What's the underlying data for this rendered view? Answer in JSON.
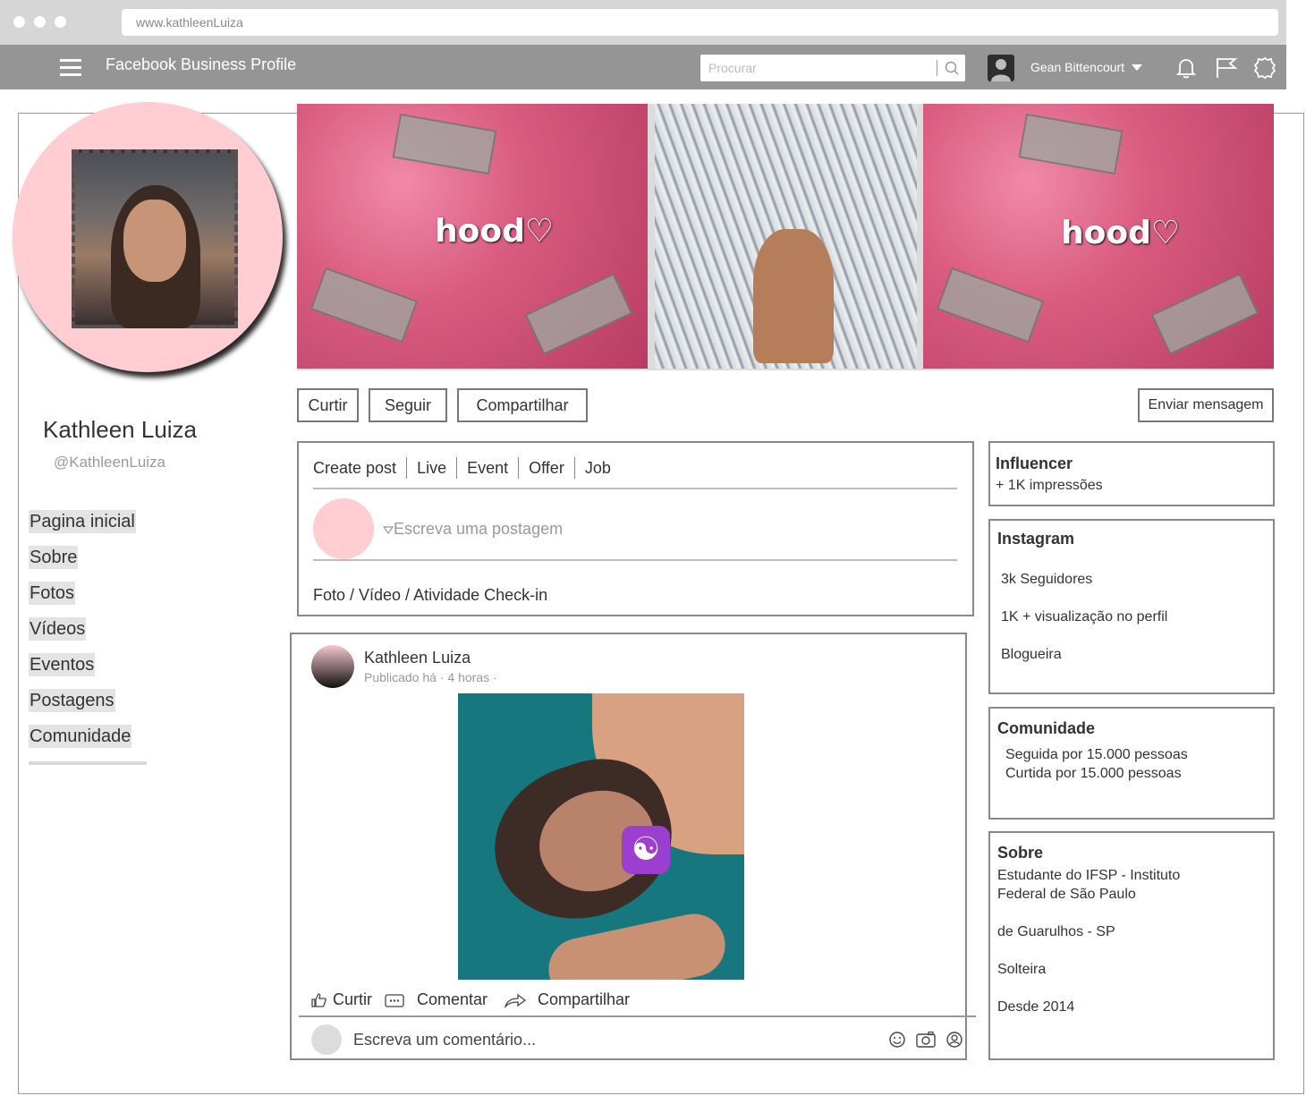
{
  "browser": {
    "url": "www.kathleenLuiza"
  },
  "appbar": {
    "title": "Facebook Business Profile",
    "search_placeholder": "Procurar",
    "user_name": "Gean Bittencourt"
  },
  "profile": {
    "name": "Kathleen Luiza",
    "handle": "@KathleenLuiza"
  },
  "nav": {
    "items": [
      "Pagina inicial",
      "Sobre",
      "Fotos",
      "Vídeos",
      "Eventos",
      "Postagens",
      "Comunidade"
    ]
  },
  "cover": {
    "overlay_text": "hood♡"
  },
  "actions": {
    "like": "Curtir",
    "follow": "Seguir",
    "share": "Compartilhar",
    "message": "Enviar mensagem"
  },
  "composer": {
    "tabs": [
      "Create post",
      "Live",
      "Event",
      "Offer",
      "Job"
    ],
    "placeholder": "Escreva uma postagem",
    "media": "Foto / Vídeo / Atividade Check-in"
  },
  "post": {
    "author": "Kathleen Luiza",
    "meta": "Publicado há · 4 horas ·",
    "like": "Curtir",
    "comment": "Comentar",
    "share": "Compartilhar",
    "comment_placeholder": "Escreva um comentário..."
  },
  "cards": {
    "influencer": {
      "title": "Influencer",
      "lines": [
        "+ 1K impressões"
      ]
    },
    "instagram": {
      "title": "Instagram",
      "lines": [
        "3k Seguidores",
        "1K + visualização no perfil",
        "Blogueira"
      ]
    },
    "community": {
      "title": "Comunidade",
      "lines": [
        "Seguida por 15.000 pessoas",
        "Curtida por 15.000 pessoas"
      ]
    },
    "about": {
      "title": "Sobre",
      "lines": [
        "Estudante do IFSP - Instituto",
        "Federal de São Paulo",
        "de Guarulhos - SP",
        "Solteira",
        "Desde 2014"
      ]
    }
  },
  "icons": {
    "search": "search-icon",
    "bell": "bell-icon",
    "flag": "flag-icon",
    "settings": "gear-icon",
    "like": "thumbs-up-icon",
    "comment": "comment-icon",
    "share": "share-arrow-icon",
    "emoji": "smiley-icon",
    "camera": "camera-icon",
    "sticker": "sticker-icon"
  },
  "colors": {
    "appbar": "#959595",
    "chrome": "#d6d6d6",
    "avatar_pink": "#ffcdd2"
  }
}
